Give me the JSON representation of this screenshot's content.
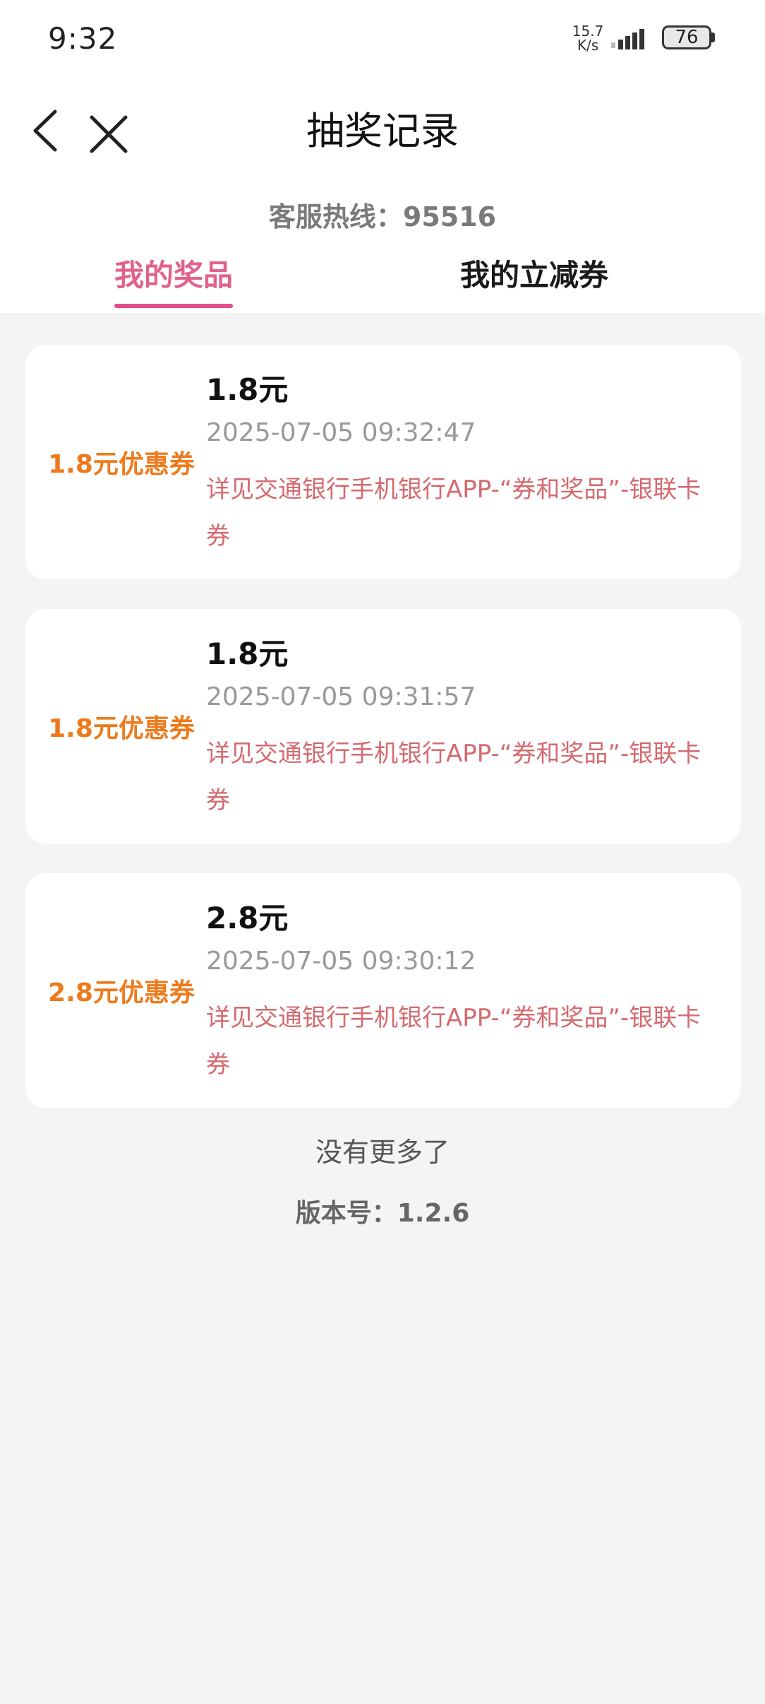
{
  "status_bar": {
    "time": "9:32",
    "net_speed_value": "15.7",
    "net_speed_unit": "K/s",
    "battery": "76",
    "icons": [
      "signal-icon",
      "battery-icon"
    ]
  },
  "nav": {
    "title": "抽奖记录",
    "back_icon": "chevron-left-icon",
    "close_icon": "close-icon"
  },
  "hotline": "客服热线：95516",
  "tabs": [
    {
      "label": "我的奖品",
      "active": true
    },
    {
      "label": "我的立减券",
      "active": false
    }
  ],
  "colors": {
    "accent_pink": "#e24e8d",
    "badge_orange": "#ee7a1b",
    "desc_red": "#d46a6f",
    "background": "#f4f4f4"
  },
  "records": [
    {
      "badge": "1.8元优惠券",
      "amount": "1.8元",
      "time": "2025-07-05 09:32:47",
      "desc": "详见交通银行手机银行APP-“券和奖品”-银联卡券"
    },
    {
      "badge": "1.8元优惠券",
      "amount": "1.8元",
      "time": "2025-07-05 09:31:57",
      "desc": "详见交通银行手机银行APP-“券和奖品”-银联卡券"
    },
    {
      "badge": "2.8元优惠券",
      "amount": "2.8元",
      "time": "2025-07-05 09:30:12",
      "desc": "详见交通银行手机银行APP-“券和奖品”-银联卡券"
    }
  ],
  "footer": {
    "no_more": "没有更多了",
    "version": "版本号：1.2.6"
  }
}
